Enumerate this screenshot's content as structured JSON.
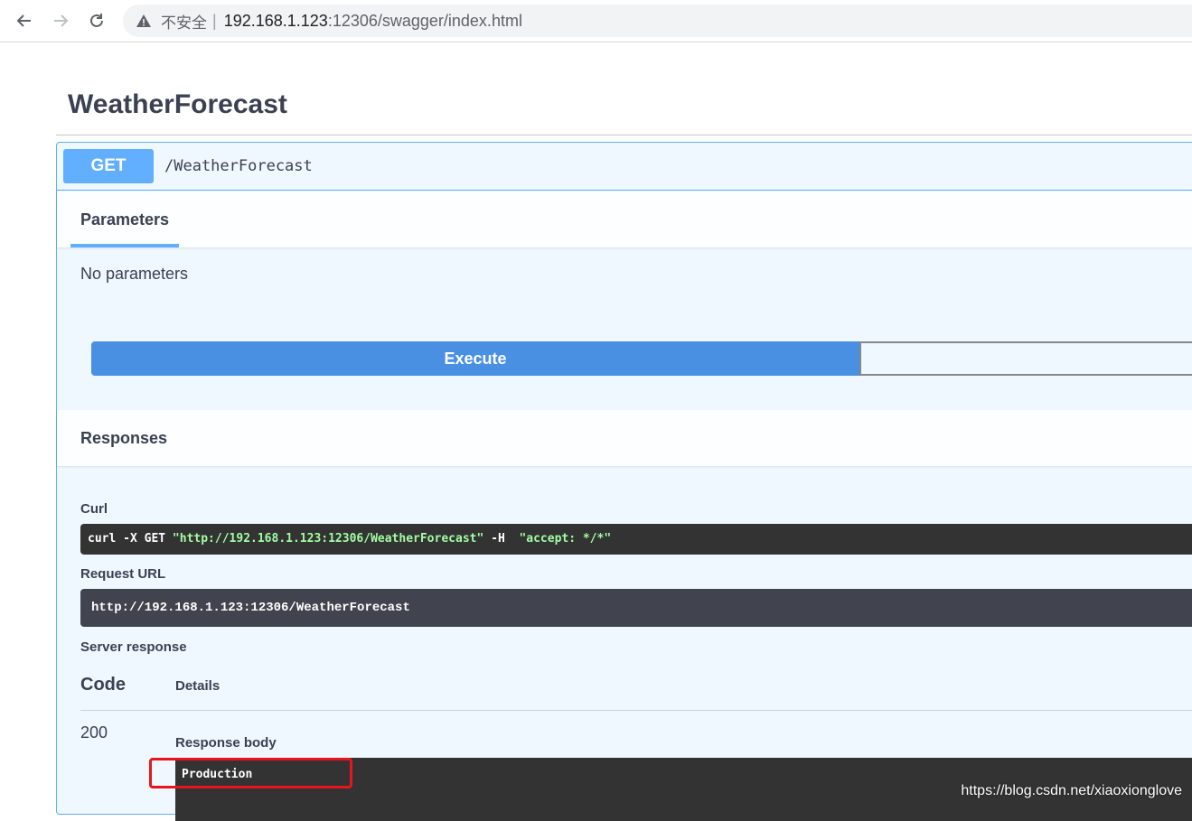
{
  "browser": {
    "security_label": "不安全",
    "separator": "|",
    "url_host": "192.168.1.123",
    "url_path": ":12306/swagger/index.html"
  },
  "icons": {
    "back": "arrow-left-icon",
    "forward": "arrow-right-icon",
    "reload": "reload-icon",
    "warning": "warning-triangle-icon"
  },
  "colors": {
    "get_method": "#61affe",
    "execute_button": "#4990e2",
    "code_bg": "#333333",
    "request_url_bg": "#41444e",
    "highlight": "#e8151d"
  },
  "swagger": {
    "tag_title": "WeatherForecast",
    "operation": {
      "method": "GET",
      "path": "/WeatherForecast"
    },
    "parameters": {
      "tab_label": "Parameters",
      "empty_text": "No parameters"
    },
    "execute_label": "Execute",
    "responses": {
      "title": "Responses",
      "curl_label": "Curl",
      "curl": {
        "cmd": "curl -X GET ",
        "url": "\"http://192.168.1.123:12306/WeatherForecast\"",
        "flag": " -H  ",
        "header": "\"accept: */*\""
      },
      "request_url_label": "Request URL",
      "request_url": "http://192.168.1.123:12306/WeatherForecast",
      "server_response_label": "Server response",
      "col_code": "Code",
      "col_details": "Details",
      "status_code": "200",
      "response_body_label": "Response body",
      "response_body": "Production"
    }
  },
  "watermark": "https://blog.csdn.net/xiaoxionglove"
}
